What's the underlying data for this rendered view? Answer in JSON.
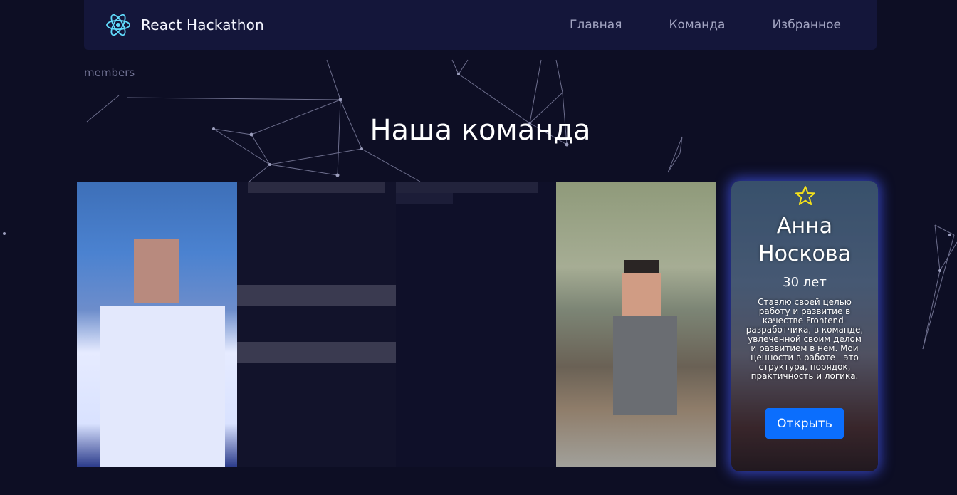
{
  "navbar": {
    "brand_title": "React Hackathon",
    "brand_icon": "react-atom-icon",
    "links": [
      "Главная",
      "Команда",
      "Избранное"
    ]
  },
  "breadcrumb": "members",
  "page_title": "Наша команда",
  "featured_member": {
    "name": "Анна Носкова",
    "age": "30 лет",
    "description": "Ставлю своей целью работу и развитие в качестве Frontend-разработчика, в команде, увлеченной своим делом и развитием в нем. Мои ценности в работе - это структура, порядок, практичность и логика.",
    "button_label": "Открыть",
    "favorite_icon": "star-icon"
  },
  "colors": {
    "background": "#0d0e24",
    "navbar": "#14163a",
    "accent_button": "#0b6efd",
    "star": "#f5e11a",
    "react_icon": "#61dafb",
    "card_glow": "#465aff"
  }
}
